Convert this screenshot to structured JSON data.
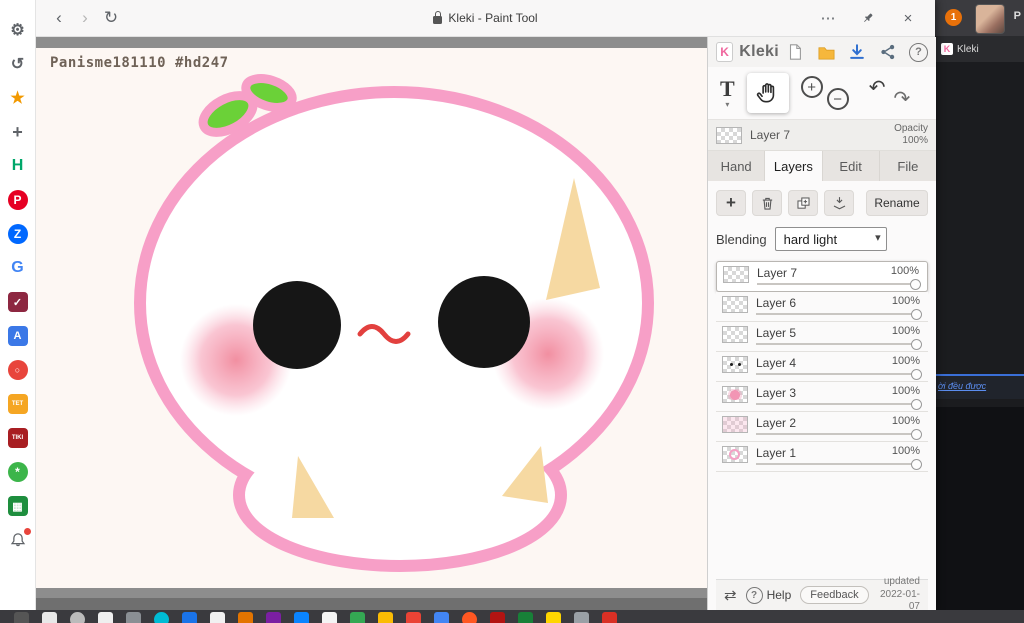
{
  "colors": {
    "accent_pink": "#f79fc7",
    "blush_pink": "#f0788c",
    "leaf_green": "#6bd138",
    "tan": "#f6d9a2",
    "download_blue": "#2f6fd0",
    "folder_yellow": "#f6b73c"
  },
  "browser": {
    "title": "Kleki - Paint Tool",
    "controls": {
      "back": "‹",
      "forward": "›",
      "reload": "↻",
      "more": "⋯",
      "close": "×"
    }
  },
  "canvas": {
    "watermark": "Panisme181110 #hd247"
  },
  "sidebar": {
    "icons": [
      {
        "glyph": "⚙"
      },
      {
        "glyph": "↺"
      },
      {
        "glyph": "★"
      },
      {
        "glyph": "+"
      },
      {
        "glyph": "H"
      },
      {
        "glyph": "P"
      },
      {
        "glyph": "Z"
      },
      {
        "glyph": "G"
      },
      {
        "glyph": "✓"
      },
      {
        "glyph": "A"
      },
      {
        "glyph": "○"
      },
      {
        "glyph": "TET"
      },
      {
        "glyph": "TIKI"
      },
      {
        "glyph": "*"
      },
      {
        "glyph": "▦"
      }
    ]
  },
  "panel": {
    "brand": "Kleki",
    "brand_initial": "K",
    "header": {
      "help": "?"
    },
    "toolbar": {
      "text_tool": "T",
      "caret": "▾",
      "zoom_in": "+",
      "zoom_out": "−",
      "undo": "↶",
      "redo": "↷"
    },
    "layer_bar": {
      "name": "Layer 7",
      "opacity_label": "Opacity",
      "opacity_value": "100%"
    },
    "tabs": [
      {
        "label": "Hand"
      },
      {
        "label": "Layers"
      },
      {
        "label": "Edit"
      },
      {
        "label": "File"
      }
    ],
    "actions": {
      "add": "+",
      "rename": "Rename"
    },
    "blending": {
      "label": "Blending",
      "value": "hard light"
    },
    "layers": [
      {
        "name": "Layer 7",
        "opacity": "100%"
      },
      {
        "name": "Layer 6",
        "opacity": "100%"
      },
      {
        "name": "Layer 5",
        "opacity": "100%"
      },
      {
        "name": "Layer 4",
        "opacity": "100%"
      },
      {
        "name": "Layer 3",
        "opacity": "100%"
      },
      {
        "name": "Layer 2",
        "opacity": "100%"
      },
      {
        "name": "Layer 1",
        "opacity": "100%"
      }
    ],
    "footer": {
      "swap": "⇄",
      "help_q": "?",
      "help_label": "Help",
      "feedback": "Feedback",
      "updated_top": "updated",
      "updated_bottom": "2022-01-07"
    }
  },
  "side_window": {
    "badge": "1",
    "p": "P",
    "brand": "Kleki",
    "brand_initial": "K",
    "snippet": "ời đều được"
  }
}
